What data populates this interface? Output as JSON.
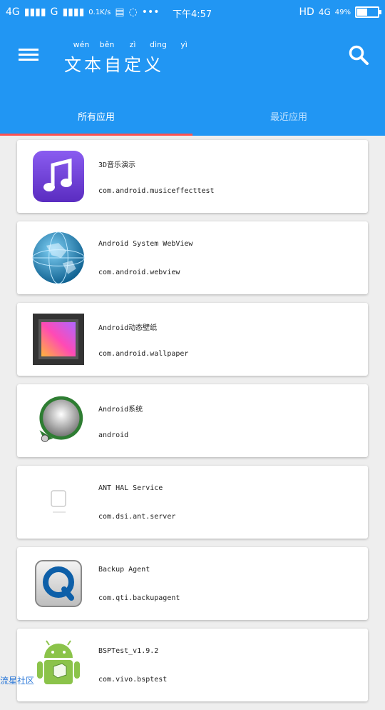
{
  "status_bar": {
    "network": "4G",
    "net2": "G",
    "speed": "0.1K/s",
    "more": "•••",
    "time": "下午4:57",
    "hd": "HD",
    "net3": "4G",
    "battery": "49%",
    "battery_level": 0.49
  },
  "app_bar": {
    "title": "文本自定义",
    "pinyin": [
      "wén",
      "běn",
      "zì",
      "dìng",
      "yì"
    ]
  },
  "tabs": [
    {
      "label": "所有应用"
    },
    {
      "label": "最近应用"
    }
  ],
  "apps": [
    {
      "name": "3D音乐演示",
      "package": "com.android.musiceffecttest"
    },
    {
      "name": "Android System WebView",
      "package": "com.android.webview"
    },
    {
      "name": "Android动态壁纸",
      "package": "com.android.wallpaper"
    },
    {
      "name": "Android系统",
      "package": "android"
    },
    {
      "name": "ANT HAL Service",
      "package": "com.dsi.ant.server"
    },
    {
      "name": "Backup Agent",
      "package": "com.qti.backupagent"
    },
    {
      "name": "BSPTest_v1.9.2",
      "package": "com.vivo.bsptest"
    }
  ],
  "watermark": "流星社区",
  "icons": [
    "menu-icon",
    "search-icon",
    "music-icon",
    "globe-icon",
    "wallpaper-icon",
    "android-system-icon",
    "app-placeholder-icon",
    "backup-q-icon",
    "android-robot-icon"
  ]
}
